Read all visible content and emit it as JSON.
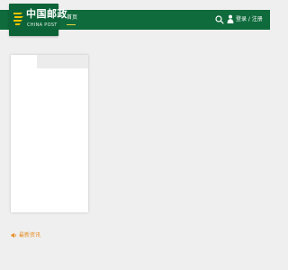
{
  "header": {
    "logo": {
      "name_cn": "中国邮政",
      "name_en": "CHINA POST"
    },
    "nav": {
      "home": "首页"
    },
    "auth": {
      "label": "登录 / 注册"
    }
  },
  "section": {
    "latest_news": "最新资讯"
  },
  "icons": {
    "search": "search-icon",
    "user": "user-icon",
    "news": "speaker-icon"
  },
  "colors": {
    "header_green": "#0f6b3c",
    "accent_orange": "#e58a1f",
    "page_bg": "#efefef"
  }
}
